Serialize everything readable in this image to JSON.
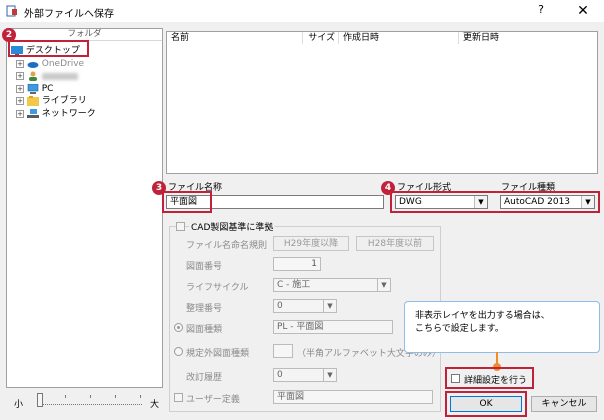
{
  "window": {
    "title": "外部ファイルへ保存",
    "help": "?",
    "close": "✕"
  },
  "folder_panel": {
    "header": "フォルダ",
    "items": [
      {
        "label": "デスクトップ",
        "icon": "desktop-icon"
      },
      {
        "label": "OneDrive",
        "icon": "onedrive-icon"
      },
      {
        "label": "",
        "icon": "user-icon"
      },
      {
        "label": "PC",
        "icon": "pc-icon"
      },
      {
        "label": "ライブラリ",
        "icon": "library-icon"
      },
      {
        "label": "ネットワーク",
        "icon": "network-icon"
      }
    ],
    "expander": "+"
  },
  "file_list": {
    "columns": [
      "名前",
      "サイズ",
      "作成日時",
      "更新日時"
    ]
  },
  "filename": {
    "label": "ファイル名称",
    "value": "平面図"
  },
  "file_format": {
    "label": "ファイル形式",
    "value": "DWG"
  },
  "file_type": {
    "label": "ファイル種類",
    "value": "AutoCAD 2013"
  },
  "cad_group": {
    "checkbox_label": "CAD製図基準に準拠",
    "naming_rule_label": "ファイル名命名規則",
    "btn_h29_after": "H29年度以降",
    "btn_h28_before": "H28年度以前",
    "drawing_number_label": "図面番号",
    "drawing_number_value": "1",
    "lifecycle_label": "ライフサイクル",
    "lifecycle_value": "C - 施工",
    "sort_number_label": "整理番号",
    "sort_number_value": "0",
    "drawing_type_label": "図面種類",
    "drawing_type_value": "PL - 平面図",
    "non_standard_label": "規定外図面種類",
    "non_standard_hint": "（半角アルファベット大文字のみ）",
    "revision_label": "改訂履歴",
    "revision_value": "0",
    "user_definition_label": "ユーザー定義",
    "user_definition_value": "平面図"
  },
  "tooltip": {
    "line1": "非表示レイヤを出力する場合は、",
    "line2": "こちらで設定します。"
  },
  "detail_setting": {
    "label": "詳細設定を行う"
  },
  "buttons": {
    "ok": "OK",
    "cancel": "キャンセル"
  },
  "slider": {
    "small_label": "小",
    "large_label": "大",
    "position_fraction": 0.0
  },
  "badges": [
    "2",
    "3",
    "4"
  ],
  "colors": {
    "highlight_red": "#c0223a",
    "tooltip_orange": "#ef8b2a",
    "selection_blue": "#0078d7"
  }
}
